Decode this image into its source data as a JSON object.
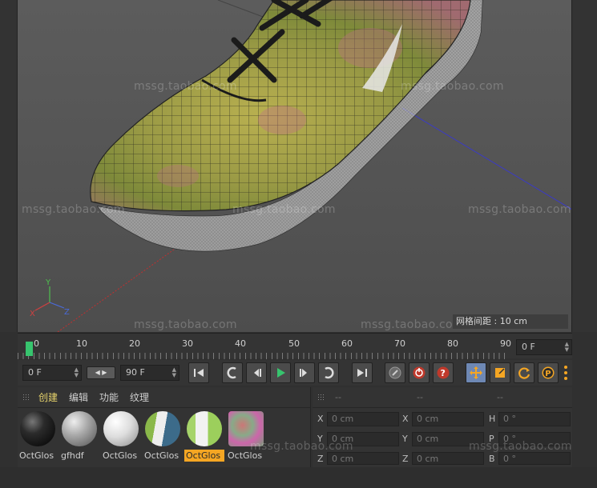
{
  "viewport": {
    "grid_spacing": "网格间距 : 10 cm",
    "watermark": "mssg.taobao.com",
    "axis_labels": {
      "y": "Y",
      "x": "X",
      "z": "Z"
    }
  },
  "timeline": {
    "ticks": [
      "0",
      "10",
      "20",
      "30",
      "40",
      "50",
      "60",
      "70",
      "80",
      "90"
    ],
    "current_frame": "0 F"
  },
  "transport": {
    "start_frame": "0 F",
    "end_frame": "90 F"
  },
  "materials": {
    "menu": [
      "创建",
      "编辑",
      "功能",
      "纹理"
    ],
    "items": [
      {
        "label": "OctGlos"
      },
      {
        "label": "gfhdf"
      },
      {
        "label": "OctGlos"
      },
      {
        "label": "OctGlos"
      },
      {
        "label": "OctGlos"
      },
      {
        "label": "OctGlos"
      }
    ]
  },
  "attributes": {
    "headers": [
      "--",
      "--",
      "--"
    ],
    "rows": [
      {
        "a1": "X",
        "v1": "0 cm",
        "a2": "X",
        "v2": "0 cm",
        "a3": "H",
        "v3": "0 °"
      },
      {
        "a1": "Y",
        "v1": "0 cm",
        "a2": "Y",
        "v2": "0 cm",
        "a3": "P",
        "v3": "0 °"
      },
      {
        "a1": "Z",
        "v1": "0 cm",
        "a2": "Z",
        "v2": "0 cm",
        "a3": "B",
        "v3": "0 °"
      }
    ]
  },
  "colors": {
    "playhead": "#37c46e",
    "selected_material": "#f5a623",
    "tool_active": "#6e88b4",
    "record_red": "#c0392b"
  }
}
